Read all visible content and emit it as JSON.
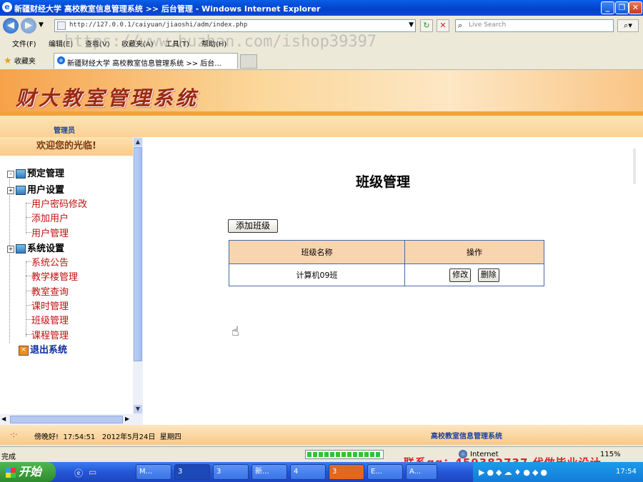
{
  "window": {
    "title": "新疆财经大学 高校教室信息管理系统 >> 后台管理 - Windows Internet Explorer",
    "min_label": "_",
    "max_label": "❐",
    "close_label": "✕"
  },
  "address": {
    "url": "http://127.0.0.1/caiyuan/jiaoshi/adm/index.php",
    "search_placeholder": "Live Search",
    "watermark": "https://www.huzhan.com/ishop39397"
  },
  "menu": [
    "文件(F)",
    "编辑(E)",
    "查看(V)",
    "收藏夹(A)",
    "工具(T)",
    "帮助(H)"
  ],
  "tabs": {
    "favorites": "收藏夹",
    "active_tab": "新疆财经大学 高校教室信息管理系统 >> 后台..."
  },
  "app": {
    "title": "财大教室管理系统",
    "admin_label": "管理员",
    "welcome": "欢迎您的光临!"
  },
  "tree": {
    "booking": "预定管理",
    "users": "用户设置",
    "user_items": [
      "用户密码修改",
      "添加用户",
      "用户管理"
    ],
    "system": "系统设置",
    "system_items": [
      "系统公告",
      "教学楼管理",
      "教室查询",
      "课时管理",
      "班级管理",
      "课程管理"
    ],
    "exit": "退出系统"
  },
  "main": {
    "page_title": "班级管理",
    "add_button": "添加班级",
    "columns": [
      "班级名称",
      "操作"
    ],
    "rows": [
      {
        "name": "计算机09班",
        "edit": "修改",
        "delete": "删除"
      }
    ]
  },
  "footer": {
    "greeting": "傍晚好!",
    "time": "17:54:51",
    "date": "2012年5月24日",
    "weekday": "星期四",
    "system_name": "高校教室信息管理系统"
  },
  "status": {
    "text": "完成",
    "zone": "Internet",
    "zoom": "115%",
    "contact": "联系qq：459382737 代做毕业设计"
  },
  "taskbar": {
    "start": "开始",
    "buttons": [
      "M...",
      "3",
      "3",
      "新...",
      "4",
      "3",
      "E...",
      "A..."
    ],
    "clock": "17:54"
  }
}
